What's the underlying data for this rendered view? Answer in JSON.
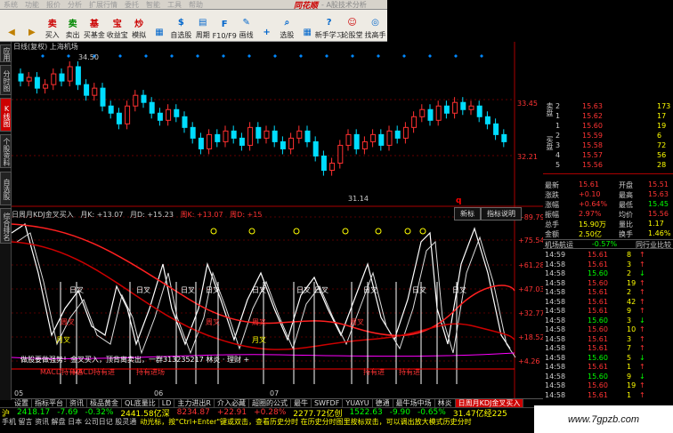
{
  "menu": {
    "items": [
      "系统",
      "功能",
      "报价",
      "分析",
      "扩展行情",
      "委托",
      "智能",
      "工具",
      "帮助"
    ],
    "brand": "同花顺",
    "subtitle": "- A股技术分析"
  },
  "toolbar": [
    {
      "label": "",
      "icon": "back",
      "color": "#c08000"
    },
    {
      "label": "",
      "icon": "forward",
      "color": "#c08000"
    },
    {
      "label": "买入",
      "icon": "卖",
      "color": "#c00"
    },
    {
      "label": "卖出",
      "icon": "卖",
      "color": "#080"
    },
    {
      "label": "买基金",
      "icon": "基",
      "color": "#c00"
    },
    {
      "label": "收益宝",
      "icon": "宝",
      "color": "#c00"
    },
    {
      "label": "模拟",
      "icon": "炒",
      "color": "#c00"
    },
    {
      "label": "",
      "icon": "grid",
      "color": "#06c"
    },
    {
      "label": "自选股",
      "icon": "$",
      "color": "#06c"
    },
    {
      "label": "周期",
      "icon": "▤",
      "color": "#06c"
    },
    {
      "label": "F10/F9",
      "icon": "F",
      "color": "#06c"
    },
    {
      "label": "画线",
      "icon": "✎",
      "color": "#06c"
    },
    {
      "label": "",
      "icon": "+",
      "color": "#06c"
    },
    {
      "label": "选股",
      "icon": "⌕",
      "color": "#06c"
    },
    {
      "label": "",
      "icon": "▦",
      "color": "#06c"
    },
    {
      "label": "新手学习",
      "icon": "?",
      "color": "#06c"
    },
    {
      "label": "论股堂",
      "icon": "☺",
      "color": "#c00"
    },
    {
      "label": "找高手",
      "icon": "◎",
      "color": "#06c"
    }
  ],
  "left_tabs": [
    {
      "label": "应用",
      "active": false
    },
    {
      "label": "分时图",
      "active": false
    },
    {
      "label": "K线图",
      "active": true
    },
    {
      "label": "个股资料",
      "active": false
    },
    {
      "label": "自选股",
      "active": false
    },
    {
      "label": "综合排名",
      "active": false
    }
  ],
  "chart": {
    "title": "日线(复权)  上海机场",
    "price_high_label": "34.50",
    "price_low_label": "31.14",
    "axis_top": [
      "33.45",
      "32.21"
    ],
    "ind_axis": [
      "+89.79",
      "+75.54",
      "+61.28",
      "+47.03",
      "+32.77",
      "+18.52",
      "+4.26"
    ],
    "date_labels": [
      "05",
      "06",
      "07"
    ],
    "indicator_head": {
      "name": "日周月KDJ金叉买入",
      "k_label": "月K: +13.07",
      "d_label": "月D: +15.23",
      "wk_label": "周K: +13.07",
      "wd_label": "周D: +15"
    },
    "indicator_tabs": [
      "新标",
      "指标说明"
    ],
    "q_mark": "q",
    "signal_text": "做股要做强势！金叉买入，顶背离卖出，一群313235217 林炎 · 理财 +",
    "cross_label": "日叉",
    "weekcross_label": "周叉",
    "monthcross_label": "月叉",
    "bottom_labels": [
      "MACD持有进",
      "MACD持有进",
      "持有进场",
      "持有进",
      "持有进"
    ]
  },
  "quote_panel": {
    "sell_label": "卖盘",
    "buy_label": "买盘",
    "sells": [
      {
        "lv": "2",
        "price": "15.63",
        "vol": "173"
      },
      {
        "lv": "1",
        "price": "15.62",
        "vol": "17"
      },
      {
        "lv": "1",
        "price": "15.60",
        "vol": "19"
      }
    ],
    "buys": [
      {
        "lv": "2",
        "price": "15.59",
        "vol": "6"
      },
      {
        "lv": "3",
        "price": "15.58",
        "vol": "72"
      },
      {
        "lv": "4",
        "price": "15.57",
        "vol": "56"
      },
      {
        "lv": "5",
        "price": "15.56",
        "vol": "28"
      }
    ],
    "stats": [
      {
        "l": "最新",
        "v": "15.61",
        "l2": "开盘",
        "v2": "15.51"
      },
      {
        "l": "涨跌",
        "v": "+0.10",
        "l2": "最高",
        "v2": "15.63"
      },
      {
        "l": "涨幅",
        "v": "+0.64%",
        "l2": "最低",
        "v2": "15.45"
      },
      {
        "l": "振幅",
        "v": "2.97%",
        "l2": "均价",
        "v2": "15.56"
      },
      {
        "l": "总手",
        "v": "15.90万",
        "l2": "量比",
        "v2": "1.17"
      },
      {
        "l": "金额",
        "v": "2.50亿",
        "l2": "换手",
        "v2": "1.46%"
      }
    ],
    "tick_tabs": [
      "机场航运",
      "-0.57%",
      "同行业比较"
    ],
    "ticks": [
      {
        "t": "14:59",
        "p": "15.61",
        "v": "8",
        "d": "up"
      },
      {
        "t": "14:58",
        "p": "15.61",
        "v": "3",
        "d": "up"
      },
      {
        "t": "14:58",
        "p": "15.60",
        "v": "2",
        "d": "down"
      },
      {
        "t": "14:58",
        "p": "15.60",
        "v": "19",
        "d": "up"
      },
      {
        "t": "14:58",
        "p": "15.61",
        "v": "2",
        "d": "up"
      },
      {
        "t": "14:58",
        "p": "15.61",
        "v": "42",
        "d": "up"
      },
      {
        "t": "14:58",
        "p": "15.61",
        "v": "9",
        "d": "up"
      },
      {
        "t": "14:58",
        "p": "15.60",
        "v": "3",
        "d": "down"
      },
      {
        "t": "14:58",
        "p": "15.60",
        "v": "10",
        "d": "up"
      },
      {
        "t": "14:58",
        "p": "15.61",
        "v": "3",
        "d": "up"
      },
      {
        "t": "14:58",
        "p": "15.61",
        "v": "7",
        "d": "up"
      },
      {
        "t": "14:58",
        "p": "15.60",
        "v": "5",
        "d": "down"
      },
      {
        "t": "14:58",
        "p": "15.61",
        "v": "1",
        "d": "up"
      },
      {
        "t": "14:58",
        "p": "15.60",
        "v": "9",
        "d": "down"
      },
      {
        "t": "14:58",
        "p": "15.60",
        "v": "19",
        "d": "up"
      },
      {
        "t": "14:58",
        "p": "15.61",
        "v": "1",
        "d": "up"
      }
    ]
  },
  "bottom_tabs": [
    {
      "label": "设置",
      "active": false
    },
    {
      "label": "指标平台",
      "active": false
    },
    {
      "label": "资讯",
      "active": false
    },
    {
      "label": "极品黄金",
      "active": false
    },
    {
      "label": "QL底量比",
      "active": false
    },
    {
      "label": "LD",
      "active": false
    },
    {
      "label": "主力进出R",
      "active": false
    },
    {
      "label": "介入必藏",
      "active": false
    },
    {
      "label": "超圈的公式",
      "active": false
    },
    {
      "label": "最牛",
      "active": false
    },
    {
      "label": "SWFDF",
      "active": false
    },
    {
      "label": "YUAYU",
      "active": false
    },
    {
      "label": "德通",
      "active": false
    },
    {
      "label": "最牛场中场",
      "active": false
    },
    {
      "label": "林炎",
      "active": false
    },
    {
      "label": "日周月KDJ金叉买入",
      "active": true
    }
  ],
  "status": {
    "idx_label": "沪",
    "idx_value": "2418.17",
    "idx_change": "-7.69",
    "idx_pct": "-0.32%",
    "idx_amount": "2441.58亿深",
    "sz_value": "8234.87",
    "sz_change": "+22.91",
    "sz_pct": "+0.28%",
    "sz_amount": "2277.72亿创",
    "cy_value": "1522.63",
    "cy_change": "-9.90",
    "cy_pct": "-0.65%",
    "cy_amount": "31.47亿经225"
  },
  "hint": {
    "left": "手机 留言 资讯 解盘 日本 公司日记 股灵通",
    "text": "动光标，按\"Ctrl+Enter\"键或双击，查看历史分时 在历史分时图里按标双击，可以调出放大模式历史分时"
  },
  "watermark": "www.7gpzb.com",
  "colors": {
    "up": "#ff3030",
    "down": "#00ddff",
    "red_line": "#ff2020",
    "yellow": "#ffff00"
  }
}
